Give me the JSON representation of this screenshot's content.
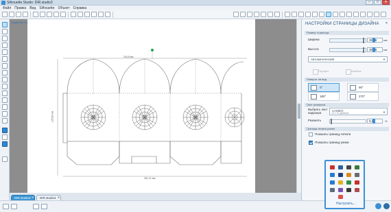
{
  "window": {
    "title": "Silhouette Studio: DIR.studio3",
    "buttons": [
      "–",
      "□",
      "✕"
    ]
  },
  "menu": [
    "Файл",
    "Правка",
    "Вид",
    "Silhouette",
    "Объект",
    "Справка"
  ],
  "design": {
    "page_label": "Заданная линия",
    "dim_top": "204,8 мм",
    "dim_left": "125,89 мм",
    "dim_bottom": "261,21 мм"
  },
  "tabs": [
    {
      "label": "DIR.studio3",
      "active": true,
      "close": "✕"
    },
    {
      "label": "DIR.studio3",
      "active": false,
      "close": "✕"
    }
  ],
  "panel": {
    "title": "НАСТРОЙКИ СТРАНИЦЫ ДИЗАЙНА",
    "close": "✕",
    "section_page": "Размер страницы",
    "width_label": "Ширина",
    "width_value": "304,8",
    "height_label": "Высота",
    "height_value": "304,8",
    "unit": "мм",
    "media_value": "Автоматический",
    "ghost_btn1": "Портрет",
    "ghost_btn2": "Альбом",
    "section_orientation": "Поворот на вид",
    "orient_options": [
      "0°",
      "90°",
      "180°",
      "270°"
    ],
    "section_cut": "Лист резервов",
    "cutter_label": "Выбрать лист",
    "cutter_label2": "каррьера",
    "cutter_value": "CAMEO",
    "cutter_sub": "12 x 12 дюймов",
    "scale_label": "Развнять",
    "scale_value": "0,0",
    "scale_unit": "%",
    "section_borders": "Граница печати ранее",
    "show_print_border": "Показать границу печати",
    "show_cut_border": "Показать границу резки"
  },
  "tray": {
    "customize_label": "Настроить..."
  },
  "colors": {
    "accent": "#3c95d2",
    "canvas_bg": "#8d8d8d",
    "page_bg": "#ffffff",
    "panel_title": "#1f4e79"
  }
}
